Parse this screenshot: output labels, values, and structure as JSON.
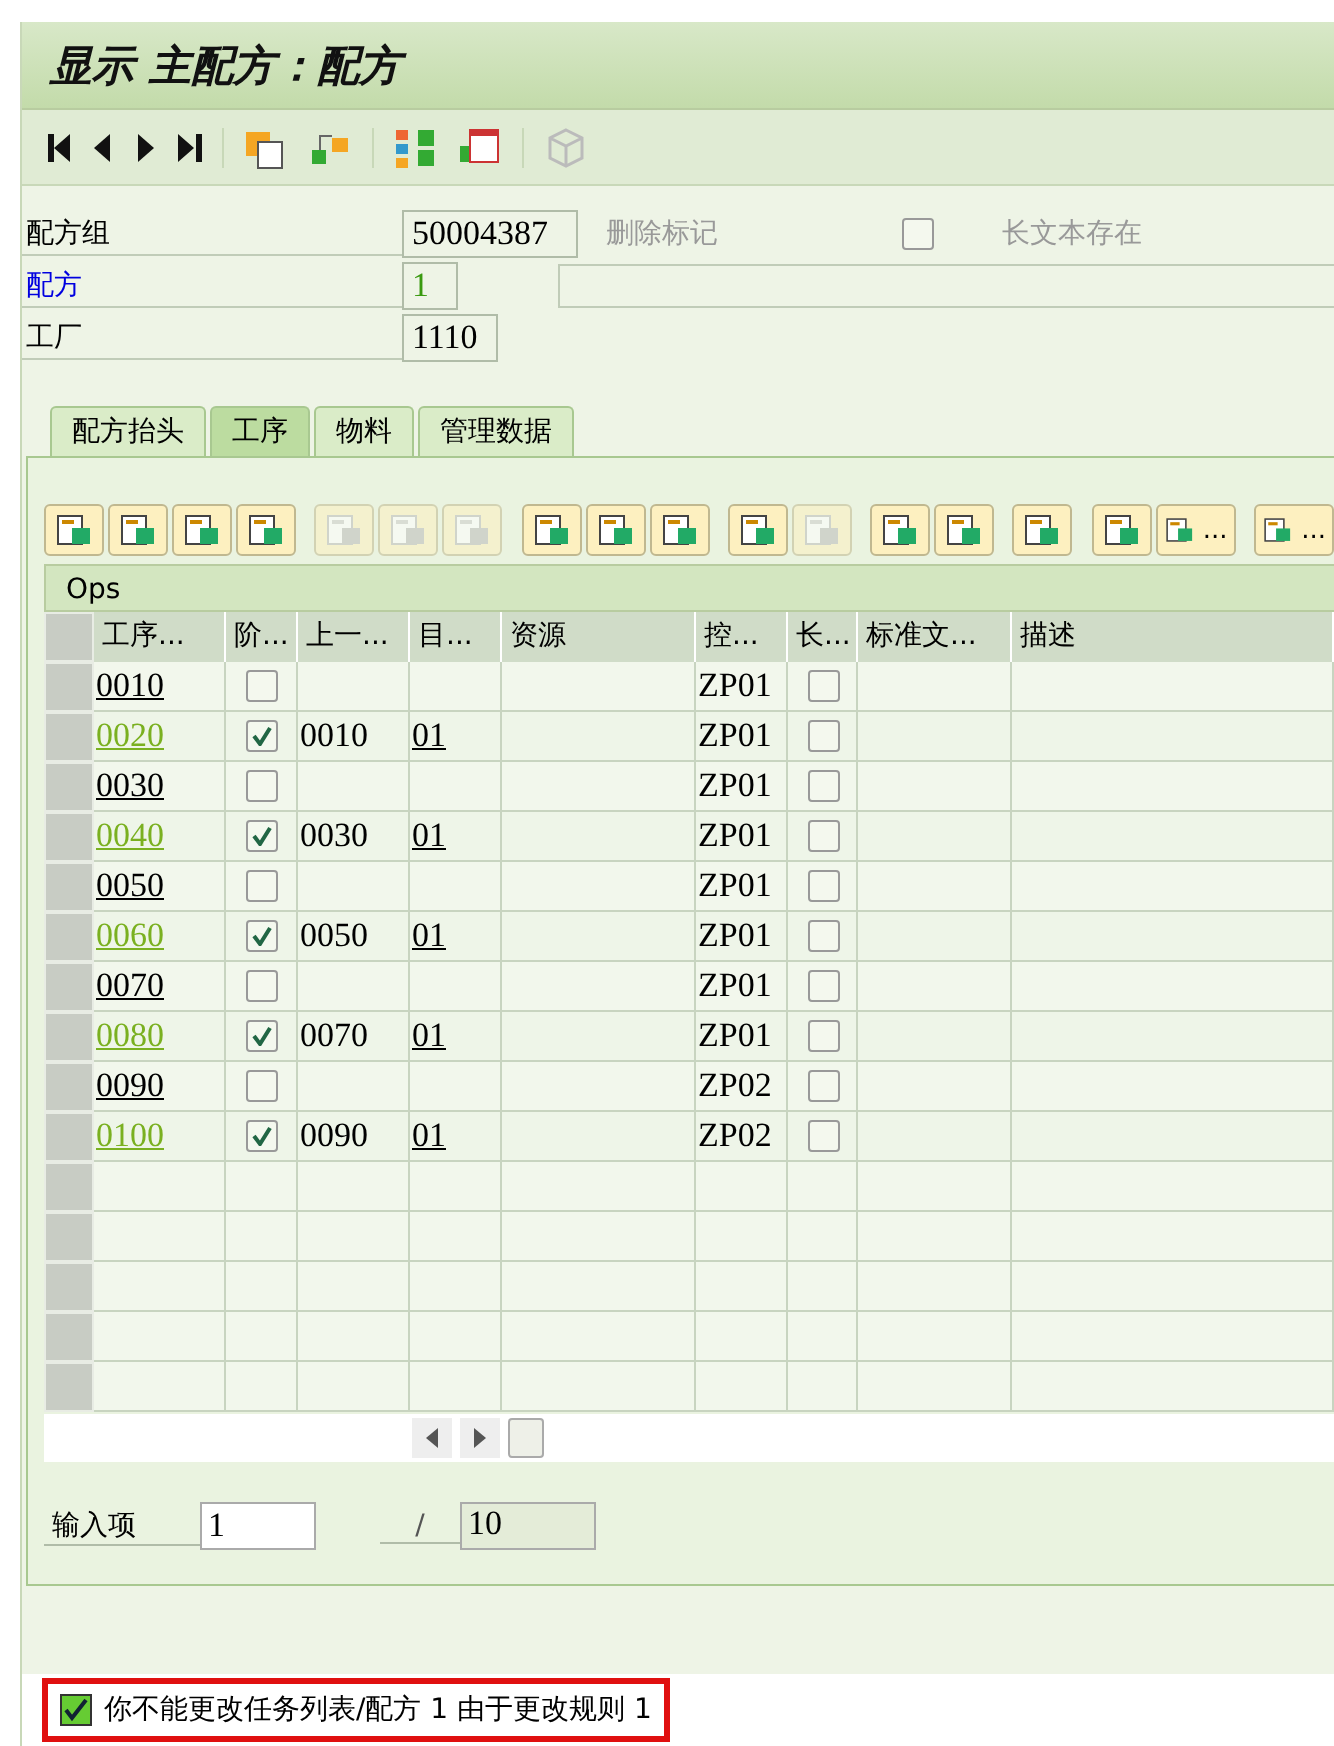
{
  "window": {
    "title": "显示 主配方：配方"
  },
  "header": {
    "recipe_group": {
      "label": "配方组",
      "value": "50004387"
    },
    "deletion_flag": {
      "label": "删除标记",
      "checked": false
    },
    "long_text": {
      "label": "长文本存在"
    },
    "recipe": {
      "label": "配方",
      "value": "1"
    },
    "plant": {
      "label": "工厂",
      "value": "1110"
    }
  },
  "tabs": [
    {
      "label": "配方抬头",
      "selected": false
    },
    {
      "label": "工序",
      "selected": true
    },
    {
      "label": "物料",
      "selected": false
    },
    {
      "label": "管理数据",
      "selected": false
    }
  ],
  "table_toolbar": [
    {
      "kind": "icon",
      "disabled": false
    },
    {
      "kind": "icon",
      "disabled": false
    },
    {
      "kind": "icon",
      "disabled": false
    },
    {
      "kind": "icon",
      "disabled": false
    },
    {
      "kind": "gap"
    },
    {
      "kind": "icon",
      "disabled": true
    },
    {
      "kind": "icon",
      "disabled": true
    },
    {
      "kind": "icon",
      "disabled": true
    },
    {
      "kind": "gap"
    },
    {
      "kind": "icon",
      "disabled": false
    },
    {
      "kind": "icon",
      "disabled": false
    },
    {
      "kind": "icon",
      "disabled": false
    },
    {
      "kind": "gap"
    },
    {
      "kind": "icon",
      "disabled": false
    },
    {
      "kind": "icon",
      "disabled": true
    },
    {
      "kind": "gap"
    },
    {
      "kind": "icon",
      "disabled": false
    },
    {
      "kind": "icon",
      "disabled": false
    },
    {
      "kind": "gap"
    },
    {
      "kind": "icon",
      "disabled": false
    },
    {
      "kind": "gap"
    },
    {
      "kind": "icon",
      "disabled": false
    },
    {
      "kind": "menu",
      "label": "..."
    },
    {
      "kind": "gap"
    },
    {
      "kind": "menu",
      "label": "..."
    }
  ],
  "table": {
    "title": "Ops",
    "columns": [
      "工序...",
      "阶...",
      "上一...",
      "目...",
      "资源",
      "控...",
      "长...",
      "标准文...",
      "描述"
    ],
    "rows": [
      {
        "operation": "0010",
        "phase": false,
        "predecessor": "",
        "target": "",
        "control_key": "ZP01",
        "long_text": false
      },
      {
        "operation": "0020",
        "phase": true,
        "predecessor": "0010",
        "target": "01",
        "control_key": "ZP01",
        "long_text": false
      },
      {
        "operation": "0030",
        "phase": false,
        "predecessor": "",
        "target": "",
        "control_key": "ZP01",
        "long_text": false
      },
      {
        "operation": "0040",
        "phase": true,
        "predecessor": "0030",
        "target": "01",
        "control_key": "ZP01",
        "long_text": false
      },
      {
        "operation": "0050",
        "phase": false,
        "predecessor": "",
        "target": "",
        "control_key": "ZP01",
        "long_text": false
      },
      {
        "operation": "0060",
        "phase": true,
        "predecessor": "0050",
        "target": "01",
        "control_key": "ZP01",
        "long_text": false
      },
      {
        "operation": "0070",
        "phase": false,
        "predecessor": "",
        "target": "",
        "control_key": "ZP01",
        "long_text": false
      },
      {
        "operation": "0080",
        "phase": true,
        "predecessor": "0070",
        "target": "01",
        "control_key": "ZP01",
        "long_text": false
      },
      {
        "operation": "0090",
        "phase": false,
        "predecessor": "",
        "target": "",
        "control_key": "ZP02",
        "long_text": false
      },
      {
        "operation": "0100",
        "phase": true,
        "predecessor": "0090",
        "target": "01",
        "control_key": "ZP02",
        "long_text": false
      }
    ]
  },
  "entry": {
    "label": "输入项",
    "value": "1",
    "separator": "/",
    "total": "10"
  },
  "status_bar": {
    "message": "你不能更改任务列表/配方 1 由于更改规则 1"
  }
}
